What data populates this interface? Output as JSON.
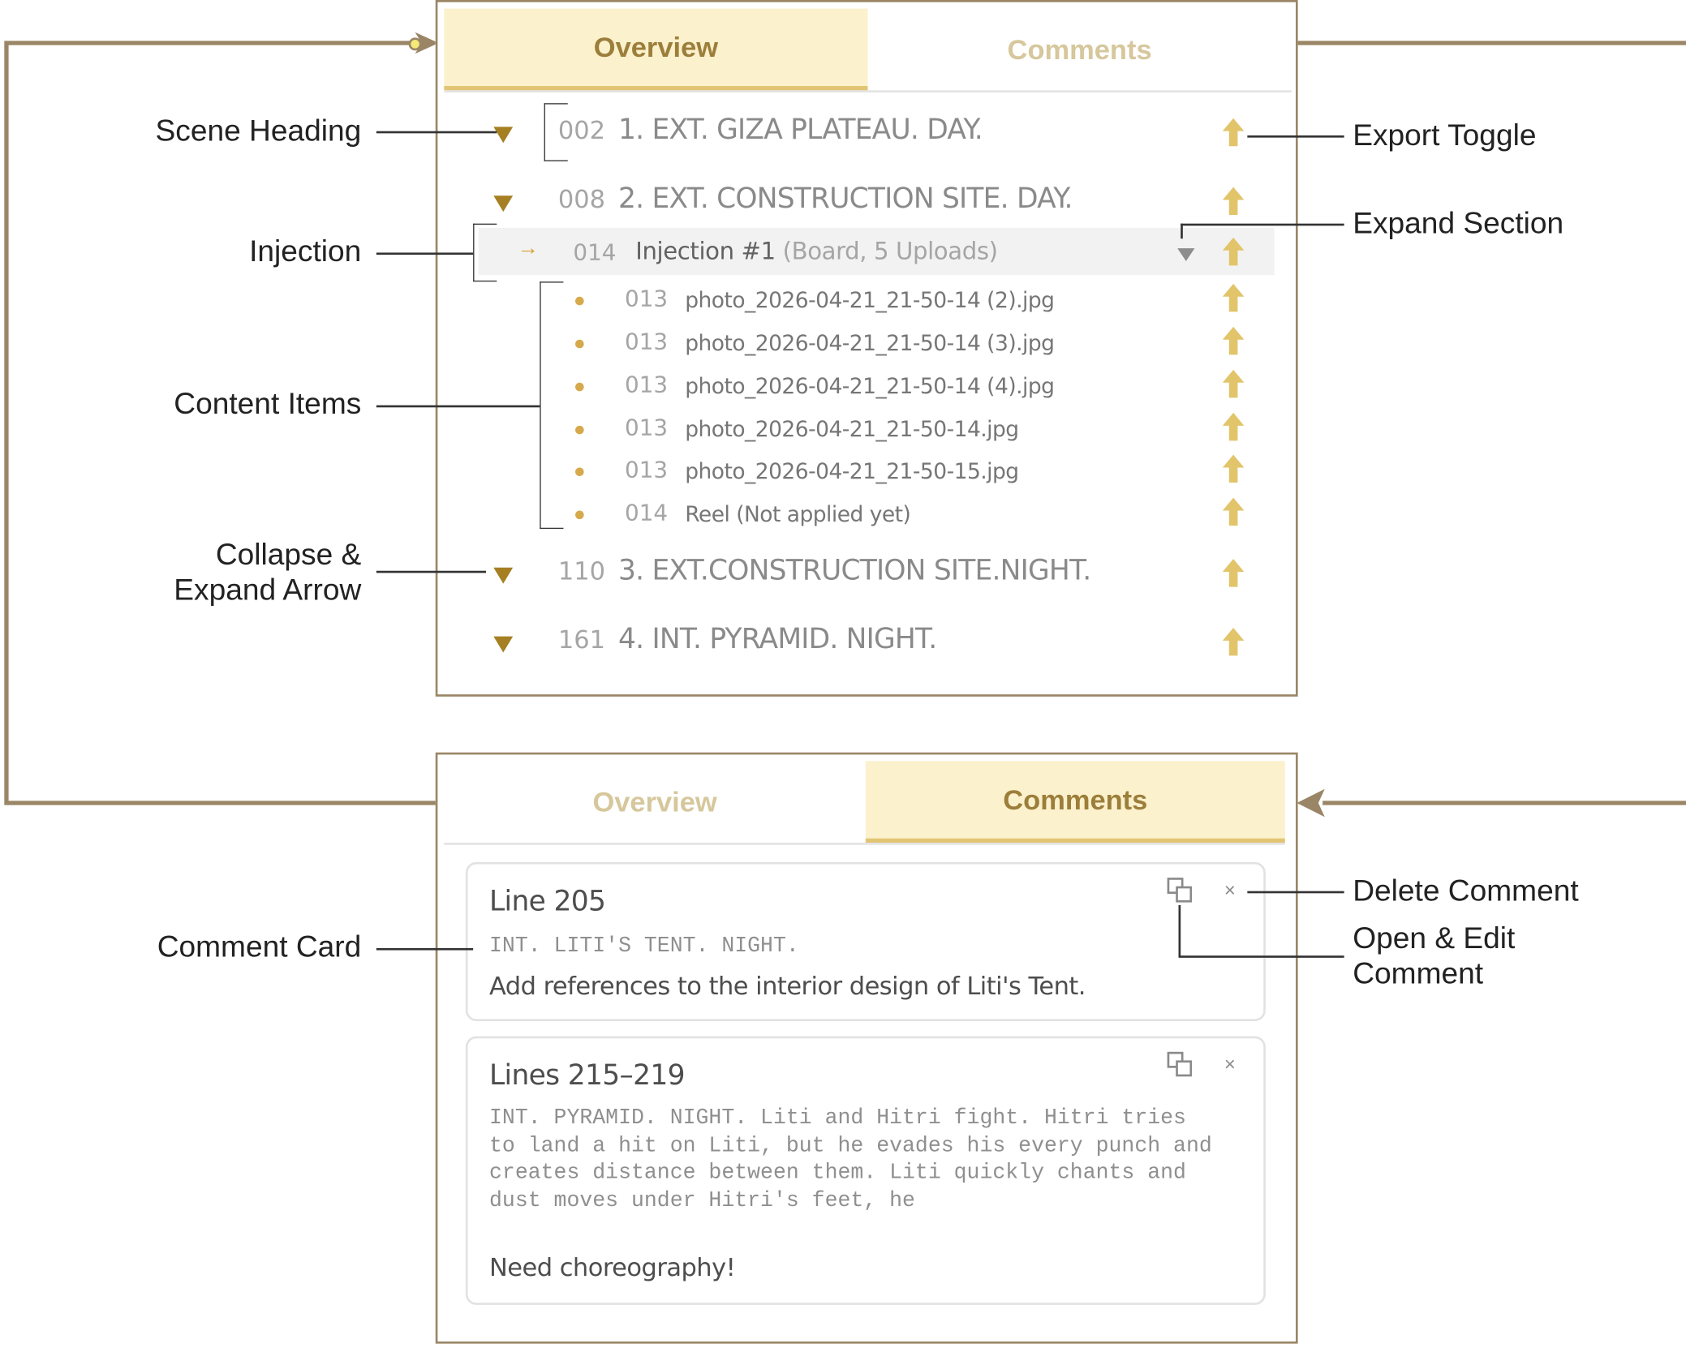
{
  "colors": {
    "accent": "#9c7e3b",
    "active_tab_bg": "#fbf1cc",
    "triangle": "#a57f22",
    "export_arrow": "#e2c46a",
    "frame": "#9a8666"
  },
  "overview_panel": {
    "tabs": [
      {
        "label": "Overview",
        "active": true
      },
      {
        "label": "Comments",
        "active": false
      }
    ],
    "scenes": [
      {
        "num": "002",
        "title": "1. EXT. GIZA PLATEAU. DAY.",
        "collapsed": false
      },
      {
        "num": "008",
        "title": "2. EXT. CONSTRUCTION SITE. DAY.",
        "collapsed": false
      },
      {
        "num": "110",
        "title": "3. EXT.CONSTRUCTION SITE.NIGHT.",
        "collapsed": false
      },
      {
        "num": "161",
        "title": "4. INT. PYRAMID. NIGHT.",
        "collapsed": false
      }
    ],
    "injection": {
      "arrow": "→",
      "num": "014",
      "title": "Injection #1",
      "meta": "(Board, 5 Uploads)"
    },
    "items": [
      {
        "num": "013",
        "name": "photo_2026-04-21_21-50-14 (2).jpg"
      },
      {
        "num": "013",
        "name": "photo_2026-04-21_21-50-14 (3).jpg"
      },
      {
        "num": "013",
        "name": "photo_2026-04-21_21-50-14 (4).jpg"
      },
      {
        "num": "013",
        "name": "photo_2026-04-21_21-50-14.jpg"
      },
      {
        "num": "013",
        "name": "photo_2026-04-21_21-50-15.jpg"
      },
      {
        "num": "014",
        "name": "Reel (Not applied yet)"
      }
    ]
  },
  "comments_panel": {
    "tabs": [
      {
        "label": "Overview",
        "active": false
      },
      {
        "label": "Comments",
        "active": true
      }
    ],
    "cards": [
      {
        "line": "Line 205",
        "script": "INT. LITI'S TENT. NIGHT.",
        "comment": "Add references to the interior design of Liti's Tent.",
        "close": "×"
      },
      {
        "line": "Lines 215–219",
        "script": "INT. PYRAMID. NIGHT. Liti and Hitri fight. Hitri tries to land a hit on Liti, but he evades his every punch and creates distance between them. Liti quickly chants and dust moves under Hitri's feet, he",
        "comment": "Need choreography!",
        "close": "×"
      }
    ]
  },
  "annotations": {
    "scene_heading": "Scene Heading",
    "injection": "Injection",
    "content_items": "Content Items",
    "collapse_expand_1": "Collapse &",
    "collapse_expand_2": "Expand Arrow",
    "export_toggle": "Export Toggle",
    "expand_section": "Expand Section",
    "comment_card": "Comment Card",
    "delete_comment": "Delete Comment",
    "open_edit_1": "Open & Edit",
    "open_edit_2": "Comment"
  }
}
